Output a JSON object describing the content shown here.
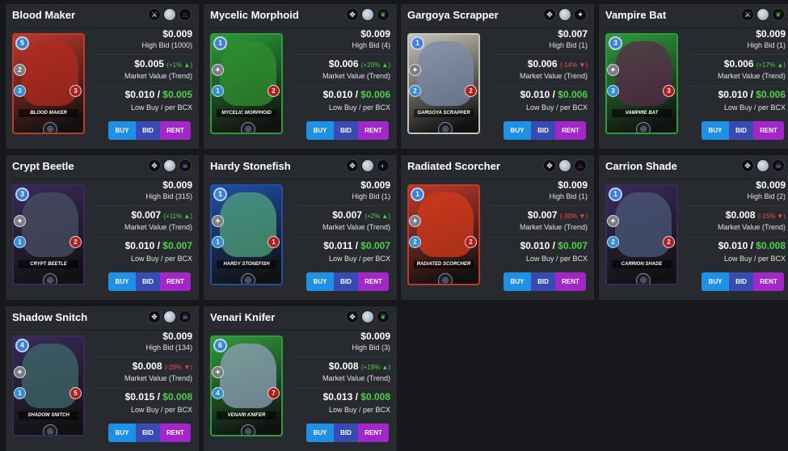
{
  "labels": {
    "high_bid_prefix": "High Bid",
    "market_value": "Market Value (Trend)",
    "low_buy": "Low Buy / per BCX",
    "buy": "BUY",
    "bid": "BID",
    "rent": "RENT"
  },
  "cards": [
    {
      "name": "Blood Maker",
      "card_label": "BLOOD MAKER",
      "badges": [
        "neutral-ability-icon",
        "silver-edition-icon",
        "fire-element-icon"
      ],
      "mana": "5",
      "melee": "2",
      "speed": "3",
      "health": "3",
      "high_bid_price": "$0.009",
      "high_bid": "High Bid (1000)",
      "market_price": "$0.005",
      "trend": "(+1% ▲)",
      "trend_dir": "up",
      "low_buy": "$0.010",
      "low_buy_green": "$0.005",
      "art_color": "#b22a1e",
      "frame_color": "#c0392b"
    },
    {
      "name": "Mycelic Morphoid",
      "card_label": "MYCELIC MORPHOID",
      "badges": [
        "crossed-swords-icon",
        "silver-edition-icon",
        "earth-element-icon"
      ],
      "mana": "1",
      "melee": "",
      "speed": "1",
      "health": "2",
      "high_bid_price": "$0.009",
      "high_bid": "High Bid (4)",
      "market_price": "$0.006",
      "trend": "(+20% ▲)",
      "trend_dir": "up",
      "low_buy": "$0.010",
      "low_buy_green": "$0.006",
      "art_color": "#2f8f2f",
      "frame_color": "#2e9c3a"
    },
    {
      "name": "Gargoya Scrapper",
      "card_label": "GARGOYA SCRAPPER",
      "badges": [
        "crossed-swords-icon",
        "silver-edition-icon",
        "neutral-element-icon"
      ],
      "mana": "1",
      "melee": "",
      "speed": "2",
      "health": "2",
      "high_bid_price": "$0.007",
      "high_bid": "High Bid (1)",
      "market_price": "$0.006",
      "trend": "(-14% ▼)",
      "trend_dir": "down",
      "low_buy": "$0.010",
      "low_buy_green": "$0.006",
      "art_color": "#7a8aa8",
      "frame_color": "#c9c4b8"
    },
    {
      "name": "Vampire Bat",
      "card_label": "VAMPIRE BAT",
      "badges": [
        "neutral-ability-icon",
        "silver-edition-icon",
        "earth-element-icon"
      ],
      "mana": "3",
      "melee": "",
      "speed": "3",
      "health": "3",
      "high_bid_price": "$0.009",
      "high_bid": "High Bid (1)",
      "market_price": "$0.006",
      "trend": "(+17% ▲)",
      "trend_dir": "up",
      "low_buy": "$0.010",
      "low_buy_green": "$0.006",
      "art_color": "#5a2a4a",
      "frame_color": "#2e9c3a"
    },
    {
      "name": "Crypt Beetle",
      "card_label": "CRYPT BEETLE",
      "badges": [
        "crossed-swords-icon",
        "silver-edition-icon",
        "death-element-icon"
      ],
      "mana": "3",
      "melee": "",
      "speed": "1",
      "health": "2",
      "high_bid_price": "$0.009",
      "high_bid": "High Bid (315)",
      "market_price": "$0.007",
      "trend": "(+11% ▲)",
      "trend_dir": "up",
      "low_buy": "$0.010",
      "low_buy_green": "$0.007",
      "art_color": "#4a4f63",
      "frame_color": "#3a2a5a"
    },
    {
      "name": "Hardy Stonefish",
      "card_label": "HARDY STONEFISH",
      "badges": [
        "crossed-swords-icon",
        "silver-edition-icon",
        "water-element-icon"
      ],
      "mana": "1",
      "melee": "",
      "speed": "1",
      "health": "1",
      "high_bid_price": "$0.009",
      "high_bid": "High Bid (1)",
      "market_price": "$0.007",
      "trend": "(+2% ▲)",
      "trend_dir": "up",
      "low_buy": "$0.011",
      "low_buy_green": "$0.007",
      "art_color": "#4fa37a",
      "frame_color": "#1f4fa8"
    },
    {
      "name": "Radiated Scorcher",
      "card_label": "RADIATED SCORCHER",
      "badges": [
        "crossed-swords-icon",
        "silver-edition-icon",
        "fire-element-icon"
      ],
      "mana": "1",
      "melee": "",
      "speed": "2",
      "health": "2",
      "high_bid_price": "$0.009",
      "high_bid": "High Bid (1)",
      "market_price": "$0.007",
      "trend": "(-30% ▼)",
      "trend_dir": "down",
      "low_buy": "$0.010",
      "low_buy_green": "$0.007",
      "art_color": "#d23a1a",
      "frame_color": "#c0392b"
    },
    {
      "name": "Carrion Shade",
      "card_label": "CARRION SHADE",
      "badges": [
        "crossed-swords-icon",
        "silver-edition-icon",
        "death-element-icon"
      ],
      "mana": "1",
      "melee": "",
      "speed": "2",
      "health": "2",
      "high_bid_price": "$0.009",
      "high_bid": "High Bid (2)",
      "market_price": "$0.008",
      "trend": "(-15% ▼)",
      "trend_dir": "down",
      "low_buy": "$0.010",
      "low_buy_green": "$0.008",
      "art_color": "#4a5a78",
      "frame_color": "#3a2a5a"
    },
    {
      "name": "Shadow Snitch",
      "card_label": "SHADOW SNITCH",
      "badges": [
        "crossed-swords-icon",
        "silver-edition-icon",
        "death-element-icon"
      ],
      "mana": "4",
      "melee": "",
      "speed": "1",
      "health": "5",
      "high_bid_price": "$0.009",
      "high_bid": "High Bid (134)",
      "market_price": "$0.008",
      "trend": "(-28% ▼)",
      "trend_dir": "down",
      "low_buy": "$0.015",
      "low_buy_green": "$0.008",
      "art_color": "#3d6a6a",
      "frame_color": "#3a2a5a"
    },
    {
      "name": "Venari Knifer",
      "card_label": "VENARI KNIFER",
      "badges": [
        "crossed-swords-icon",
        "silver-edition-icon",
        "earth-element-icon"
      ],
      "mana": "6",
      "melee": "",
      "speed": "4",
      "health": "7",
      "high_bid_price": "$0.009",
      "high_bid": "High Bid (3)",
      "market_price": "$0.008",
      "trend": "(+19% ▲)",
      "trend_dir": "up",
      "low_buy": "$0.013",
      "low_buy_green": "$0.008",
      "art_color": "#8fa0b8",
      "frame_color": "#2e9c3a"
    }
  ]
}
